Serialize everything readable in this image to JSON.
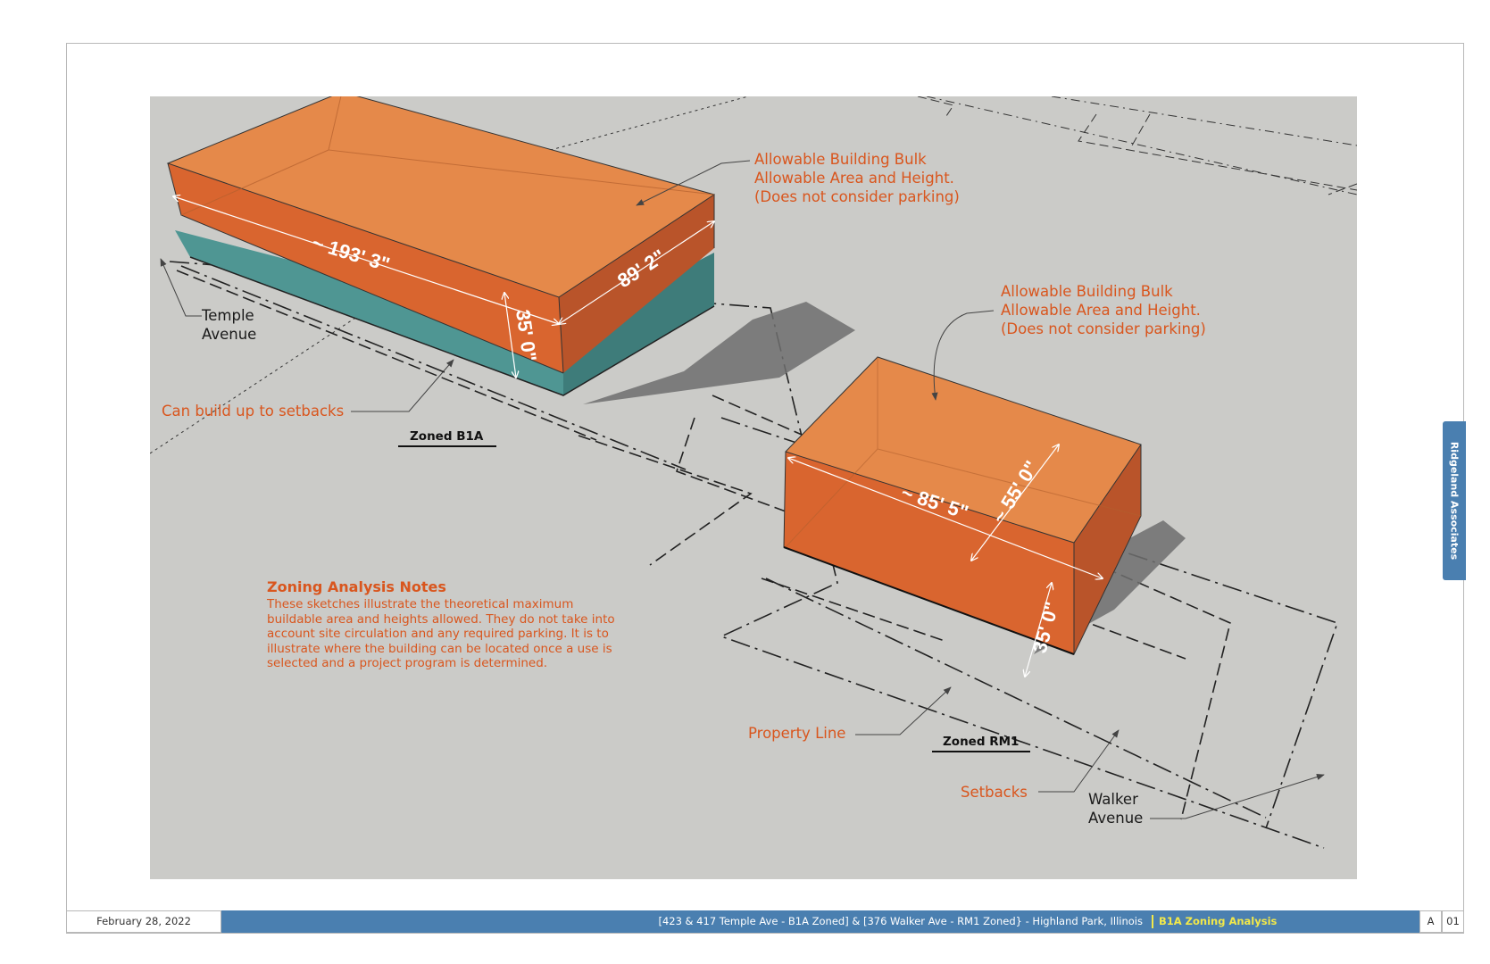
{
  "canvas": {
    "colors": {
      "ground": "#cbcbc8",
      "massing_orange": "#d9652f",
      "massing_top": "#e5894a",
      "existing_teal": "#4f9693",
      "label_red": "#d9561e",
      "footer_blue": "#4a7fb0",
      "footer_highlight": "#f2e84a"
    }
  },
  "site_b1a": {
    "zone_label": "Zoned B1A",
    "dim_length": "~ 193' 3\"",
    "dim_width": "89' 2\"",
    "dim_height": "35' 0\"",
    "bulk_callout": [
      "Allowable Building Bulk",
      "Allowable Area and Height.",
      "(Does not consider parking)"
    ],
    "street_callout": [
      "Temple",
      "Avenue"
    ],
    "setback_callout": "Can build up to setbacks"
  },
  "site_rm1": {
    "zone_label": "Zoned RM1",
    "dim_length": "~ 85' 5\"",
    "dim_width": "~ 55' 0\"",
    "dim_height": "35' 0\"",
    "bulk_callout": [
      "Allowable Building Bulk",
      "Allowable Area and Height.",
      "(Does not consider parking)"
    ],
    "property_callout": "Property Line",
    "setbacks_callout": "Setbacks",
    "street_callout": [
      "Walker",
      "Avenue"
    ]
  },
  "notes": {
    "title": "Zoning Analysis Notes",
    "lines": [
      "These sketches illustrate the theoretical maximum",
      "buildable area and heights allowed. They do not take into",
      "account site circulation and any required parking. It is to",
      "illustrate where the building can be located once a use is",
      "selected and a project program is determined."
    ]
  },
  "side_tab": "Ridgeland Associates",
  "footer": {
    "date": "February 28, 2022",
    "project": "[423 & 417 Temple Ave - B1A Zoned]  & [376 Walker Ave - RM1 Zoned} - Highland Park, Illinois",
    "sheet_title": "B1A Zoning Analysis",
    "sheet_letter": "A",
    "sheet_number": "01"
  }
}
